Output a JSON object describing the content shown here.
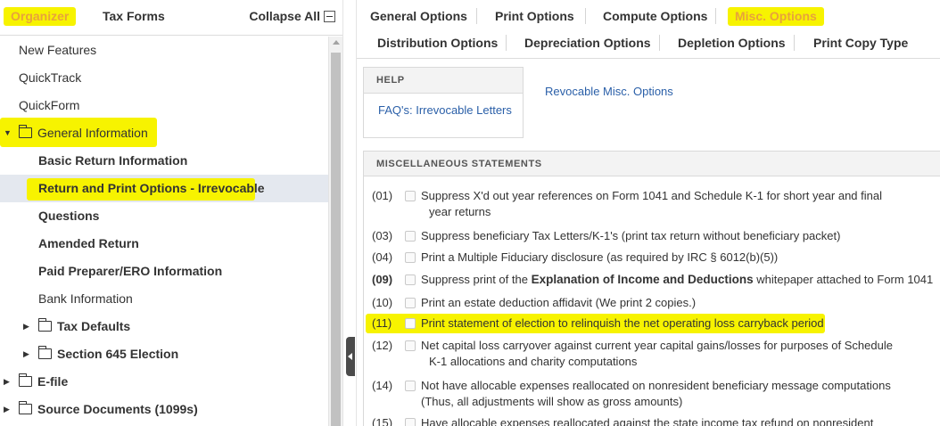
{
  "left_header": {
    "organizer": "Organizer",
    "tax_forms": "Tax Forms",
    "collapse_all": "Collapse All"
  },
  "tree": [
    {
      "label": "New Features",
      "level": 0,
      "folder": false,
      "bold": false
    },
    {
      "label": "QuickTrack",
      "level": 0,
      "folder": false,
      "bold": false
    },
    {
      "label": "QuickForm",
      "level": 0,
      "folder": false,
      "bold": false
    },
    {
      "label": "General Information",
      "level": 0,
      "folder": true,
      "expanded": true,
      "highlight": true
    },
    {
      "label": "Basic Return Information",
      "level": 1,
      "folder": false,
      "bold": true
    },
    {
      "label": "Return and Print Options - Irrevocable",
      "level": 1,
      "folder": false,
      "bold": true,
      "selected": true,
      "highlight": true
    },
    {
      "label": "Questions",
      "level": 1,
      "folder": false,
      "bold": true
    },
    {
      "label": "Amended Return",
      "level": 1,
      "folder": false,
      "bold": true
    },
    {
      "label": "Paid Preparer/ERO Information",
      "level": 1,
      "folder": false,
      "bold": true
    },
    {
      "label": "Bank Information",
      "level": 1,
      "folder": false,
      "bold": false
    },
    {
      "label": "Tax Defaults",
      "level": 1,
      "folder": true,
      "bold": true
    },
    {
      "label": "Section 645 Election",
      "level": 1,
      "folder": true,
      "bold": true
    },
    {
      "label": "E-file",
      "level": 0,
      "folder": true,
      "bold": true
    },
    {
      "label": "Source Documents (1099s)",
      "level": 0,
      "folder": true,
      "bold": true
    }
  ],
  "option_tabs": {
    "general": "General Options",
    "print": "Print Options",
    "compute": "Compute Options",
    "misc": "Misc. Options",
    "distribution": "Distribution Options",
    "depreciation": "Depreciation Options",
    "depletion": "Depletion Options",
    "print_copy": "Print Copy Type"
  },
  "help": {
    "header": "HELP",
    "link": "FAQ's: Irrevocable Letters",
    "side_link": "Revocable Misc. Options"
  },
  "misc": {
    "header": "MISCELLANEOUS STATEMENTS",
    "statements": [
      {
        "num": "(01)",
        "lines": [
          "Suppress X'd out year references on Form 1041 and Schedule K-1 for short year and final",
          "year returns"
        ]
      },
      {
        "num": "(03)",
        "lines": [
          "Suppress beneficiary Tax Letters/K-1's (print tax return without beneficiary packet)"
        ]
      },
      {
        "num": "(04)",
        "lines": [
          "Print a Multiple Fiduciary disclosure (as required by IRC § 6012(b)(5))"
        ]
      },
      {
        "num": "(09)",
        "pre": "Suppress print of the ",
        "bold": "Explanation of Income and Deductions",
        "post": " whitepaper attached to Form 1041"
      },
      {
        "num": "(10)",
        "lines": [
          "Print an estate deduction affidavit (We print 2 copies.)"
        ]
      },
      {
        "num": "(11)",
        "lines": [
          "Print statement of election to relinquish the net operating loss carryback period"
        ],
        "highlight": true
      },
      {
        "num": "(12)",
        "lines": [
          "Net capital loss carryover against current year capital gains/losses for purposes of Schedule",
          "K-1 allocations and charity computations"
        ]
      },
      {
        "num": "(14)",
        "lines": [
          "Not have allocable expenses reallocated on nonresident beneficiary message computations",
          "(Thus, all adjustments will show as gross amounts)"
        ]
      },
      {
        "num": "(15)",
        "lines": [
          "Have allocable expenses reallocated against the state income tax refund on nonresident"
        ]
      }
    ]
  }
}
